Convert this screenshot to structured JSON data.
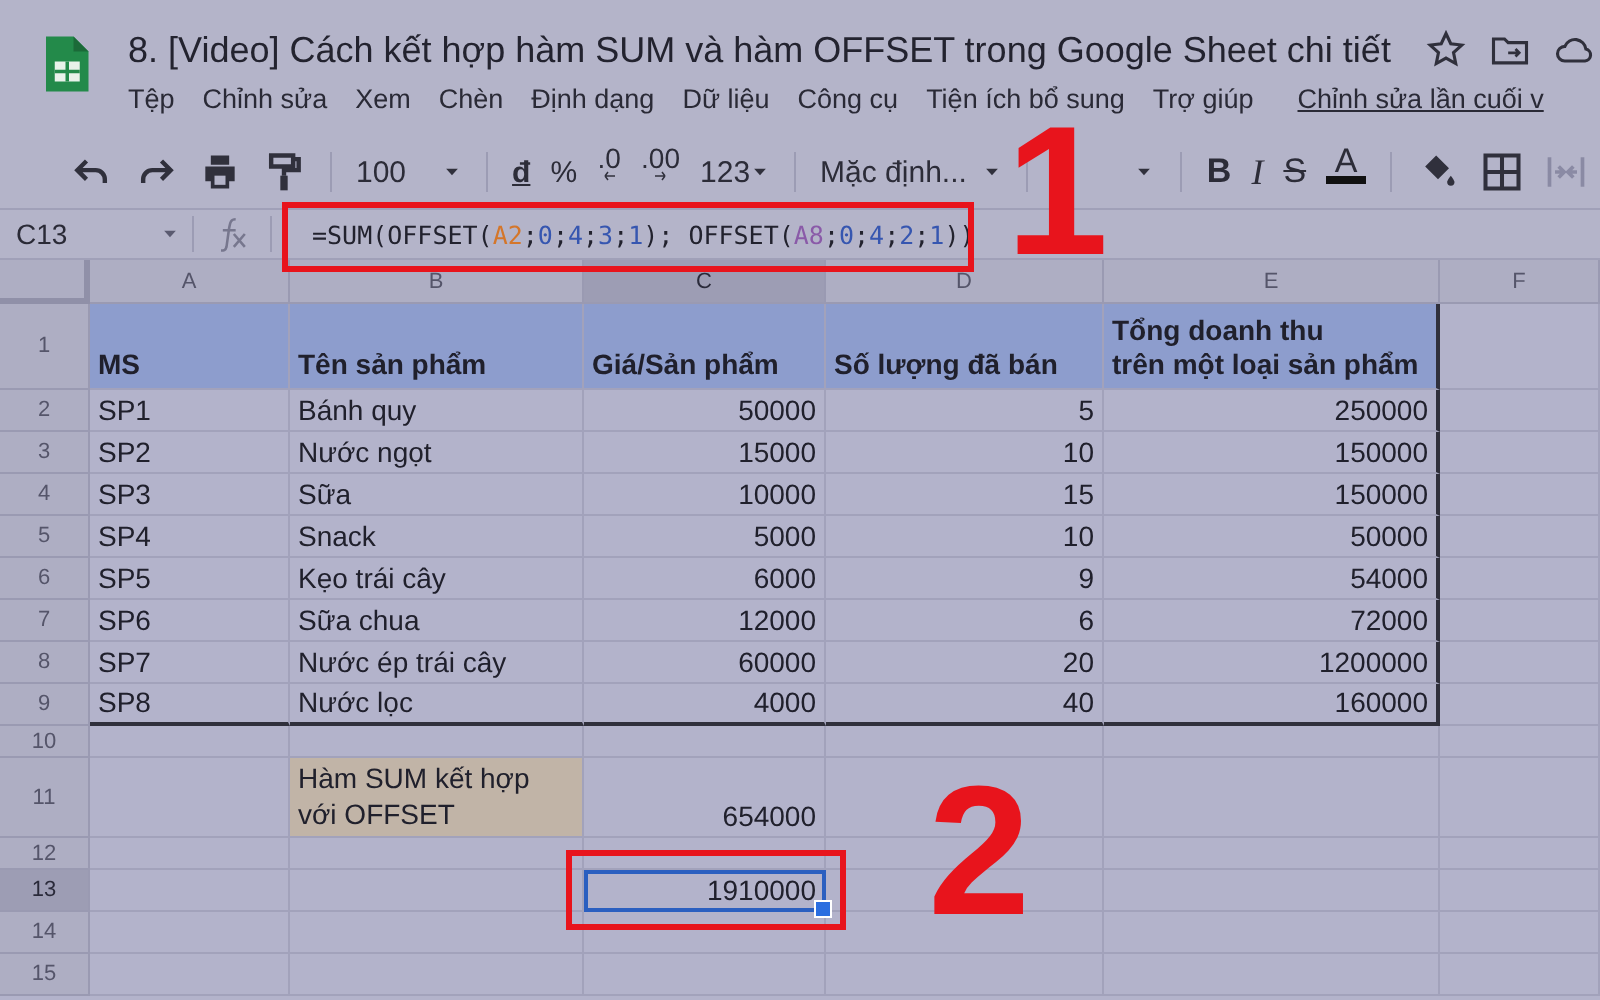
{
  "title_bar": {
    "title": "8. [Video] Cách kết hợp hàm SUM và hàm OFFSET trong Google Sheet chi tiết",
    "menu": [
      "Tệp",
      "Chỉnh sửa",
      "Xem",
      "Chèn",
      "Định dạng",
      "Dữ liệu",
      "Công cụ",
      "Tiện ích bổ sung",
      "Trợ giúp"
    ],
    "last_edit_link": "Chỉnh sửa lần cuối v"
  },
  "toolbar": {
    "zoom": "100",
    "currency": "đ",
    "percent": "%",
    "decrease_decimal": ".0",
    "increase_decimal": ".00",
    "number_format": "123",
    "font": "Mặc định...",
    "bold": "B",
    "italic": "I",
    "strikethrough": "S",
    "text_color": "A"
  },
  "formula_bar": {
    "cell_reference": "C13",
    "formula": [
      {
        "text": "=SUM(OFFSET(",
        "color": "#22222e"
      },
      {
        "text": "A2",
        "color": "#d4762a"
      },
      {
        "text": ";",
        "color": "#22222e"
      },
      {
        "text": "0",
        "color": "#3656b0"
      },
      {
        "text": ";",
        "color": "#22222e"
      },
      {
        "text": "4",
        "color": "#3656b0"
      },
      {
        "text": ";",
        "color": "#22222e"
      },
      {
        "text": "3",
        "color": "#3656b0"
      },
      {
        "text": ";",
        "color": "#22222e"
      },
      {
        "text": "1",
        "color": "#3656b0"
      },
      {
        "text": "); OFFSET(",
        "color": "#22222e"
      },
      {
        "text": "A8",
        "color": "#8a5aa8"
      },
      {
        "text": ";",
        "color": "#22222e"
      },
      {
        "text": "0",
        "color": "#3656b0"
      },
      {
        "text": ";",
        "color": "#22222e"
      },
      {
        "text": "4",
        "color": "#3656b0"
      },
      {
        "text": ";",
        "color": "#22222e"
      },
      {
        "text": "2",
        "color": "#3656b0"
      },
      {
        "text": ";",
        "color": "#22222e"
      },
      {
        "text": "1",
        "color": "#3656b0"
      },
      {
        "text": "))",
        "color": "#22222e"
      }
    ]
  },
  "sheet": {
    "columns": [
      "A",
      "B",
      "C",
      "D",
      "E",
      "F"
    ],
    "rows": [
      {
        "number": "1",
        "kind": "header",
        "cells": [
          {
            "text": "MS",
            "kind": "header",
            "selected": false
          },
          {
            "text": "Tên sản phẩm",
            "kind": "header",
            "selected": false
          },
          {
            "text": "Giá/Sản phẩm",
            "kind": "header",
            "selected": false
          },
          {
            "text": "Số lượng đã bán",
            "kind": "header",
            "selected": false
          },
          {
            "text": "Tổng doanh thu\ntrên một loại sản phẩm",
            "kind": "header",
            "selected": false
          },
          {
            "kind": "empty",
            "selected": false
          }
        ]
      },
      {
        "number": "2",
        "kind": "data",
        "cells": [
          {
            "text": "SP1",
            "kind": "text",
            "selected": false
          },
          {
            "text": "Bánh quy",
            "kind": "text",
            "selected": false
          },
          {
            "text": "50000",
            "kind": "number",
            "selected": false
          },
          {
            "text": "5",
            "kind": "number",
            "selected": false
          },
          {
            "text": "250000",
            "kind": "number",
            "selected": false
          },
          {
            "kind": "empty",
            "selected": false
          }
        ]
      },
      {
        "number": "3",
        "kind": "data",
        "cells": [
          {
            "text": "SP2",
            "kind": "text",
            "selected": false
          },
          {
            "text": "Nước ngọt",
            "kind": "text",
            "selected": false
          },
          {
            "text": "15000",
            "kind": "number",
            "selected": false
          },
          {
            "text": "10",
            "kind": "number",
            "selected": false
          },
          {
            "text": "150000",
            "kind": "number",
            "selected": false
          },
          {
            "kind": "empty",
            "selected": false
          }
        ]
      },
      {
        "number": "4",
        "kind": "data",
        "cells": [
          {
            "text": "SP3",
            "kind": "text",
            "selected": false
          },
          {
            "text": "Sữa",
            "kind": "text",
            "selected": false
          },
          {
            "text": "10000",
            "kind": "number",
            "selected": false
          },
          {
            "text": "15",
            "kind": "number",
            "selected": false
          },
          {
            "text": "150000",
            "kind": "number",
            "selected": false
          },
          {
            "kind": "empty",
            "selected": false
          }
        ]
      },
      {
        "number": "5",
        "kind": "data",
        "cells": [
          {
            "text": "SP4",
            "kind": "text",
            "selected": false
          },
          {
            "text": "Snack",
            "kind": "text",
            "selected": false
          },
          {
            "text": "5000",
            "kind": "number",
            "selected": false
          },
          {
            "text": "10",
            "kind": "number",
            "selected": false
          },
          {
            "text": "50000",
            "kind": "number",
            "selected": false
          },
          {
            "kind": "empty",
            "selected": false
          }
        ]
      },
      {
        "number": "6",
        "kind": "data",
        "cells": [
          {
            "text": "SP5",
            "kind": "text",
            "selected": false
          },
          {
            "text": "Kẹo trái cây",
            "kind": "text",
            "selected": false
          },
          {
            "text": "6000",
            "kind": "number",
            "selected": false
          },
          {
            "text": "9",
            "kind": "number",
            "selected": false
          },
          {
            "text": "54000",
            "kind": "number",
            "selected": false
          },
          {
            "kind": "empty",
            "selected": false
          }
        ]
      },
      {
        "number": "7",
        "kind": "data",
        "cells": [
          {
            "text": "SP6",
            "kind": "text",
            "selected": false
          },
          {
            "text": "Sữa chua",
            "kind": "text",
            "selected": false
          },
          {
            "text": "12000",
            "kind": "number",
            "selected": false
          },
          {
            "text": "6",
            "kind": "number",
            "selected": false
          },
          {
            "text": "72000",
            "kind": "number",
            "selected": false
          },
          {
            "kind": "empty",
            "selected": false
          }
        ]
      },
      {
        "number": "8",
        "kind": "data",
        "cells": [
          {
            "text": "SP7",
            "kind": "text",
            "selected": false
          },
          {
            "text": "Nước ép trái cây",
            "kind": "text",
            "selected": false
          },
          {
            "text": "60000",
            "kind": "number",
            "selected": false
          },
          {
            "text": "20",
            "kind": "number",
            "selected": false
          },
          {
            "text": "1200000",
            "kind": "number",
            "selected": false
          },
          {
            "kind": "empty",
            "selected": false
          }
        ]
      },
      {
        "number": "9",
        "kind": "data",
        "cells": [
          {
            "text": "SP8",
            "kind": "text",
            "selected": false
          },
          {
            "text": "Nước lọc",
            "kind": "text",
            "selected": false
          },
          {
            "text": "4000",
            "kind": "number",
            "selected": false
          },
          {
            "text": "40",
            "kind": "number",
            "selected": false
          },
          {
            "text": "160000",
            "kind": "number",
            "selected": false
          },
          {
            "kind": "empty",
            "selected": false
          }
        ]
      },
      {
        "number": "10",
        "kind": "short",
        "cells": [
          {
            "kind": "empty",
            "selected": false
          },
          {
            "kind": "empty",
            "selected": false
          },
          {
            "kind": "empty",
            "selected": false
          },
          {
            "kind": "empty",
            "selected": false
          },
          {
            "kind": "empty",
            "selected": false
          },
          {
            "kind": "empty",
            "selected": false
          }
        ]
      },
      {
        "number": "11",
        "kind": "tall",
        "cells": [
          {
            "kind": "empty",
            "selected": false
          },
          {
            "text": "Hàm SUM kết hợp với OFFSET",
            "kind": "label",
            "selected": false
          },
          {
            "text": "654000",
            "kind": "number",
            "selected": false
          },
          {
            "kind": "empty",
            "selected": false
          },
          {
            "kind": "empty",
            "selected": false
          },
          {
            "kind": "empty",
            "selected": false
          }
        ]
      },
      {
        "number": "12",
        "kind": "short",
        "cells": [
          {
            "kind": "empty",
            "selected": false
          },
          {
            "kind": "empty",
            "selected": false
          },
          {
            "kind": "empty",
            "selected": false
          },
          {
            "kind": "empty",
            "selected": false
          },
          {
            "kind": "empty",
            "selected": false
          },
          {
            "kind": "empty",
            "selected": false
          }
        ]
      },
      {
        "number": "13",
        "kind": "normal",
        "cells": [
          {
            "kind": "empty",
            "selected": false
          },
          {
            "kind": "empty",
            "selected": false
          },
          {
            "text": "1910000",
            "kind": "number",
            "selected": true
          },
          {
            "kind": "empty",
            "selected": false
          },
          {
            "kind": "empty",
            "selected": false
          },
          {
            "kind": "empty",
            "selected": false
          }
        ]
      },
      {
        "number": "14",
        "kind": "normal",
        "cells": [
          {
            "kind": "empty",
            "selected": false
          },
          {
            "kind": "empty",
            "selected": false
          },
          {
            "kind": "empty",
            "selected": false
          },
          {
            "kind": "empty",
            "selected": false
          },
          {
            "kind": "empty",
            "selected": false
          },
          {
            "kind": "empty",
            "selected": false
          }
        ]
      },
      {
        "number": "15",
        "kind": "normal",
        "cells": [
          {
            "kind": "empty",
            "selected": false
          },
          {
            "kind": "empty",
            "selected": false
          },
          {
            "kind": "empty",
            "selected": false
          },
          {
            "kind": "empty",
            "selected": false
          },
          {
            "kind": "empty",
            "selected": false
          },
          {
            "kind": "empty",
            "selected": false
          }
        ]
      }
    ]
  },
  "annotations": [
    {
      "label": "1"
    },
    {
      "label": "2"
    }
  ]
}
